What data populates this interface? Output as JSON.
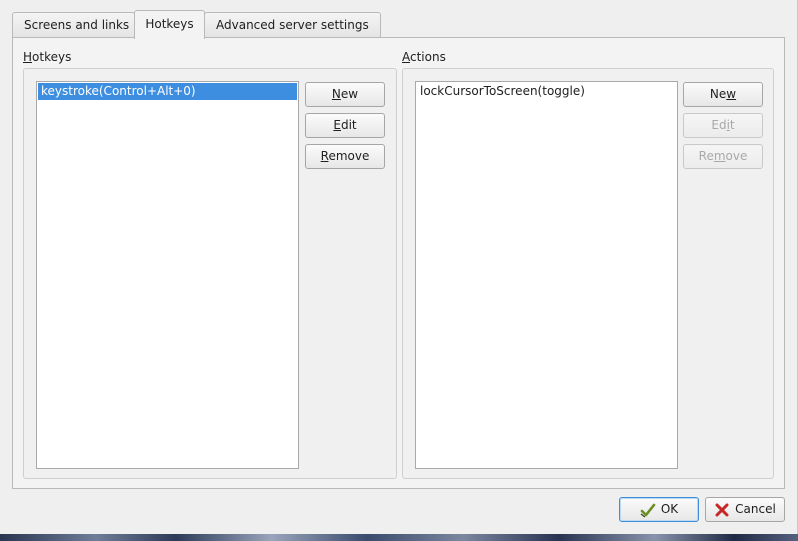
{
  "tabs": [
    {
      "label": "Screens and links",
      "active": false
    },
    {
      "label": "Hotkeys",
      "active": true
    },
    {
      "label": "Advanced server settings",
      "active": false
    }
  ],
  "hotkeys": {
    "label_mnemonic": "H",
    "label_rest": "otkeys",
    "items": [
      {
        "text": "keystroke(Control+Alt+0)",
        "selected": true
      }
    ],
    "buttons": {
      "new": {
        "pre": "",
        "mn": "N",
        "post": "ew"
      },
      "edit": {
        "pre": "",
        "mn": "E",
        "post": "dit"
      },
      "remove": {
        "pre": "",
        "mn": "R",
        "post": "emove"
      }
    }
  },
  "actions": {
    "label_mnemonic": "A",
    "label_rest": "ctions",
    "items": [
      {
        "text": "lockCursorToScreen(toggle)",
        "selected": false
      }
    ],
    "buttons": {
      "new": {
        "pre": "Ne",
        "mn": "w",
        "post": ""
      },
      "edit": {
        "pre": "Ed",
        "mn": "i",
        "post": "t",
        "disabled": true
      },
      "remove": {
        "pre": "Re",
        "mn": "m",
        "post": "ove",
        "disabled": true
      }
    }
  },
  "dialog_buttons": {
    "ok": "OK",
    "cancel": "Cancel"
  },
  "colors": {
    "selection": "#3d8ee0",
    "default_button_border": "#3f8fd8",
    "cancel_icon": "#c62828",
    "ok_icon": "#6b8e23"
  }
}
